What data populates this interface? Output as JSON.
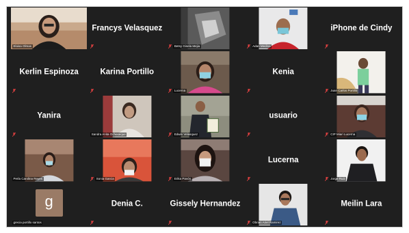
{
  "participants": [
    {
      "name": "Eloisa Olmas",
      "video": true
    },
    {
      "name": "Francys Velasquez",
      "video": false
    },
    {
      "name": "Betsy Gisela Mejia",
      "video": true
    },
    {
      "name": "Adan Medina",
      "video": true
    },
    {
      "name": "iPhone de Cindy",
      "video": false
    },
    {
      "name": "Kerlin Espinoza",
      "video": false
    },
    {
      "name": "Karina Portillo",
      "video": false
    },
    {
      "name": "Lucerna",
      "video": true
    },
    {
      "name": "Kenia",
      "video": false
    },
    {
      "name": "Juan Carlos Portillo",
      "video": true
    },
    {
      "name": "Yanira",
      "video": false
    },
    {
      "name": "Sandra Anita Ocheseque",
      "video": true
    },
    {
      "name": "Edwin Velasquez",
      "video": true
    },
    {
      "name": "usuario",
      "video": false
    },
    {
      "name": "CIP Miari Lucerna",
      "video": true
    },
    {
      "name": "Perla Carolina Reyes",
      "video": true
    },
    {
      "name": "Sonia Garcia",
      "video": true
    },
    {
      "name": "Erika Pavón",
      "video": true
    },
    {
      "name": "Lucerna",
      "video": false
    },
    {
      "name": "Jorge Ruiz",
      "video": true
    },
    {
      "name": "grecia portillo santos",
      "video": false,
      "avatar_letter": "g"
    },
    {
      "name": "Denia C.",
      "video": false
    },
    {
      "name": "Gissely Hernandez",
      "video": false
    },
    {
      "name": "Obrian Ariel Ramirez",
      "video": true
    },
    {
      "name": "Meilin Lara",
      "video": false
    }
  ]
}
